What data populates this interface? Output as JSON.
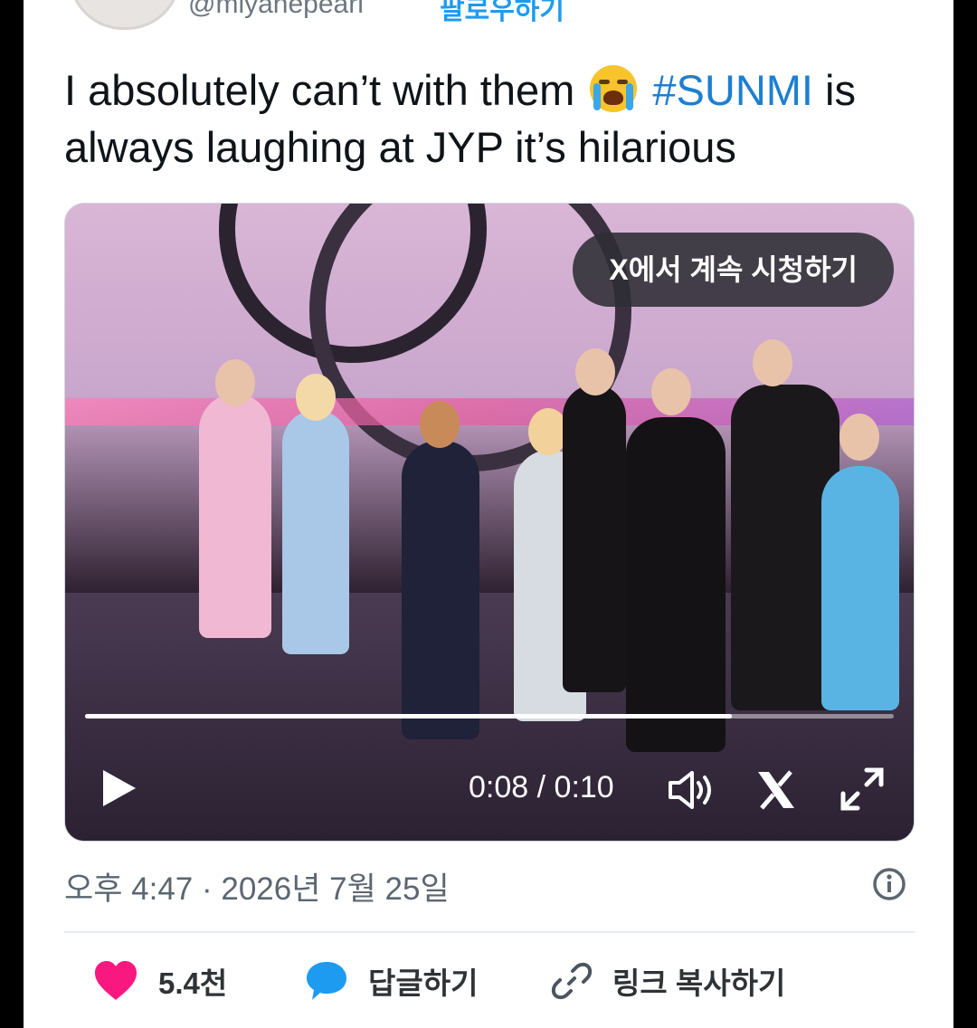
{
  "header": {
    "handle": "@miyahepeari",
    "follow_label": "팔로우하기"
  },
  "tweet": {
    "text_before": "I absolutely can’t with them ",
    "emoji_name": "loudly-crying-face-emoji",
    "hashtag": "#SUNMI",
    "text_after": " is always laughing at JYP it’s hilarious"
  },
  "video": {
    "watch_label": "X에서 계속 시청하기",
    "current_time": "0:08",
    "separator": " / ",
    "duration": "0:10",
    "progress_fraction": 0.8,
    "icons": [
      "play-icon",
      "volume-icon",
      "x-logo-icon",
      "fullscreen-icon"
    ]
  },
  "meta": {
    "timestamp": "오후 4:47 · 2026년 7월 25일"
  },
  "actions": {
    "like_count": "5.4천",
    "reply_label": "답글하기",
    "copy_link_label": "링크 복사하기"
  },
  "colors": {
    "accent": "#1d9bf0",
    "like": "#f91880",
    "text": "#0f1419",
    "muted": "#5b6670"
  }
}
